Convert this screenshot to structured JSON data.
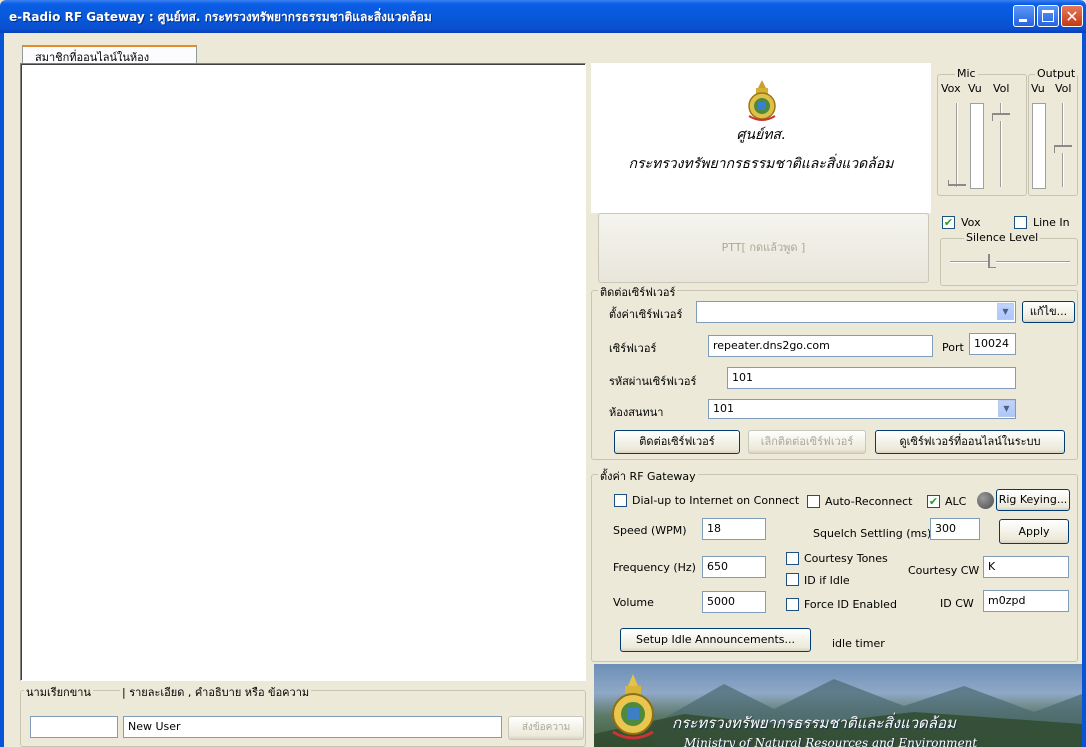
{
  "window": {
    "title": "e-Radio RF Gateway : ศูนย์ทส. กระทรวงทรัพยากรธรรมชาติและสิ่งแวดล้อม"
  },
  "members": {
    "tab_label": "สมาชิกที่ออนไลน์ในห้อง"
  },
  "chat": {
    "nick_label": "นามเรียกขาน",
    "message_label": "| รายละเอียด , คำอธิบาย หรือ ข้อความ",
    "nick_value": "",
    "message_value": "New User",
    "send_label": "ส่งข้อความ"
  },
  "org": {
    "name_line1": "ศูนย์ทส.",
    "name_line2": "กระทรวงทรัพยากรธรรมชาติและสิ่งแวดล้อม"
  },
  "ptt": {
    "label": "PTT[ กดแล้วพูด ]"
  },
  "audio": {
    "mic_label": "Mic",
    "output_label": "Output",
    "vox_col": "Vox",
    "vu_col": "Vu",
    "vol_col": "Vol",
    "out_vu_col": "Vu",
    "out_vol_col": "Vol",
    "vox_checkbox": "Vox",
    "vox_checked": true,
    "line_in_checkbox": "Line In",
    "line_in_checked": false,
    "silence_level_label": "Silence Level"
  },
  "server": {
    "group_label": "ติดต่อเซิร์ฟเวอร์",
    "preset_label": "ตั้งค่าเซิร์ฟเวอร์",
    "preset_value": "",
    "edit_button": "แก้ไข...",
    "server_label": "เซิร์ฟเวอร์",
    "server_value": "repeater.dns2go.com",
    "port_label": "Port",
    "port_value": "10024",
    "password_label": "รหัสผ่านเซิร์ฟเวอร์",
    "password_value": "101",
    "room_label": "ห้องสนทนา",
    "room_value": "101",
    "connect_button": "ติดต่อเซิร์ฟเวอร์",
    "disconnect_button": "เลิกติดต่อเซิร์ฟเวอร์",
    "online_servers_button": "ดูเซิร์ฟเวอร์ที่ออนไลน์ในระบบ"
  },
  "rf": {
    "group_label": "ตั้งค่า RF Gateway",
    "dialup_label": "Dial-up to Internet on Connect",
    "autoreconnect_label": "Auto-Reconnect",
    "alc_label": "ALC",
    "alc_checked": true,
    "rig_keying_button": "Rig Keying...",
    "speed_label": "Speed (WPM)",
    "speed_value": "18",
    "squelch_label": "Squelch Settling (ms)",
    "squelch_value": "300",
    "apply_button": "Apply",
    "frequency_label": "Frequency (Hz)",
    "frequency_value": "650",
    "courtesy_tones_label": "Courtesy Tones",
    "id_if_idle_label": "ID if Idle",
    "courtesy_cw_label": "Courtesy CW",
    "courtesy_cw_value": "K",
    "volume_label": "Volume",
    "volume_value": "5000",
    "force_id_label": "Force ID Enabled",
    "id_cw_label": "ID CW",
    "id_cw_value": "m0zpd",
    "setup_idle_button": "Setup Idle Announcements...",
    "idle_timer_label": "idle timer"
  },
  "banner": {
    "thai_text": "กระทรวงทรัพยากรธรรมชาติและสิ่งแวดล้อม",
    "english_text": "Ministry of Natural Resources and Environment"
  }
}
